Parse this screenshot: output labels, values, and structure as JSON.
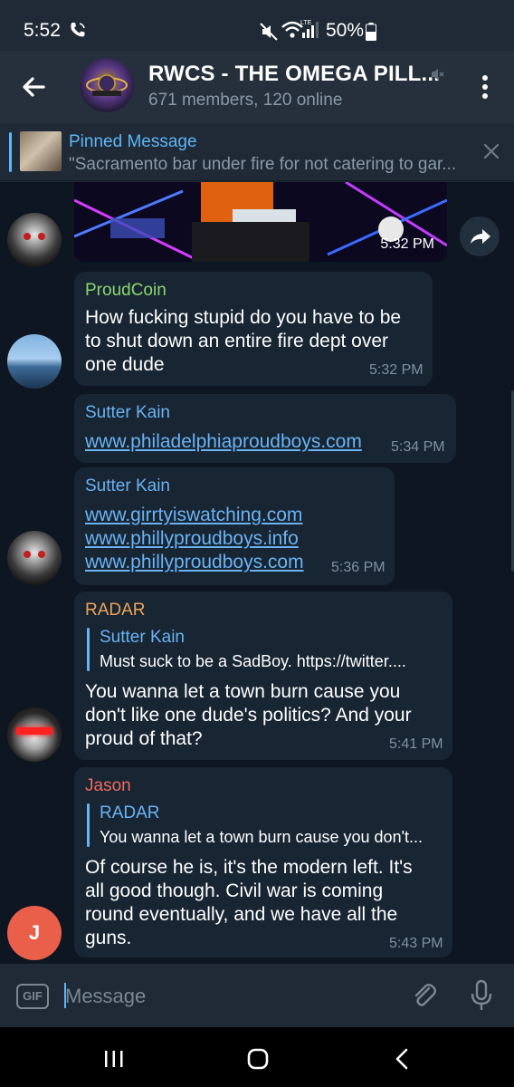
{
  "status": {
    "time": "5:52",
    "battery": "50%"
  },
  "header": {
    "title": "RWCS - THE OMEGA PILL...",
    "subtitle": "671 members, 120 online"
  },
  "pinned": {
    "title": "Pinned Message",
    "text": "\"Sacramento bar under fire for not catering to gar..."
  },
  "messages": [
    {
      "media_time": "5:32 PM"
    },
    {
      "sender": "ProudCoin",
      "sender_color": "#8bd670",
      "lines": [
        "How fucking stupid do you have to be",
        "to shut down an entire fire dept over",
        "one dude"
      ],
      "time": "5:32 PM"
    },
    {
      "sender": "Sutter Kain",
      "sender_color": "#6ab3f3",
      "links": [
        "www.philadelphiaproudboys.com"
      ],
      "time": "5:34 PM"
    },
    {
      "sender": "Sutter Kain",
      "sender_color": "#6ab3f3",
      "links": [
        "www.girrtyiswatching.com",
        "www.phillyproudboys.info",
        "www.phillyproudboys.com"
      ],
      "time": "5:36 PM"
    },
    {
      "sender": "RADAR",
      "sender_color": "#eea35b",
      "reply_name": "Sutter Kain",
      "reply_text": "Must suck to be a SadBoy.   https://twitter....",
      "lines": [
        "You wanna let a town burn cause you",
        "don't like one dude's politics?  And your",
        "proud of that?"
      ],
      "time": "5:41 PM"
    },
    {
      "sender": "Jason",
      "sender_color": "#ee6a5f",
      "reply_name": "RADAR",
      "reply_text": "You wanna let a town burn cause you don't...",
      "lines": [
        "Of course he is, it's the modern left. It's",
        "all good though. Civil war is coming",
        "round eventually, and we have all the",
        "guns."
      ],
      "time": "5:43 PM",
      "avatar_letter": "J"
    }
  ],
  "composer": {
    "gif_label": "GIF",
    "placeholder": "Message"
  },
  "colors": {
    "accent": "#5eb5f7",
    "chat_bg": "#0e1621",
    "bubble_bg": "#182533"
  },
  "icons": [
    "phone-icon",
    "mute-icon",
    "wifi-icon",
    "signal-icon",
    "battery-icon",
    "back-arrow-icon",
    "more-vert-icon",
    "close-icon",
    "share-icon",
    "attach-icon",
    "mic-icon",
    "recent-apps-icon",
    "home-icon",
    "nav-back-icon"
  ]
}
